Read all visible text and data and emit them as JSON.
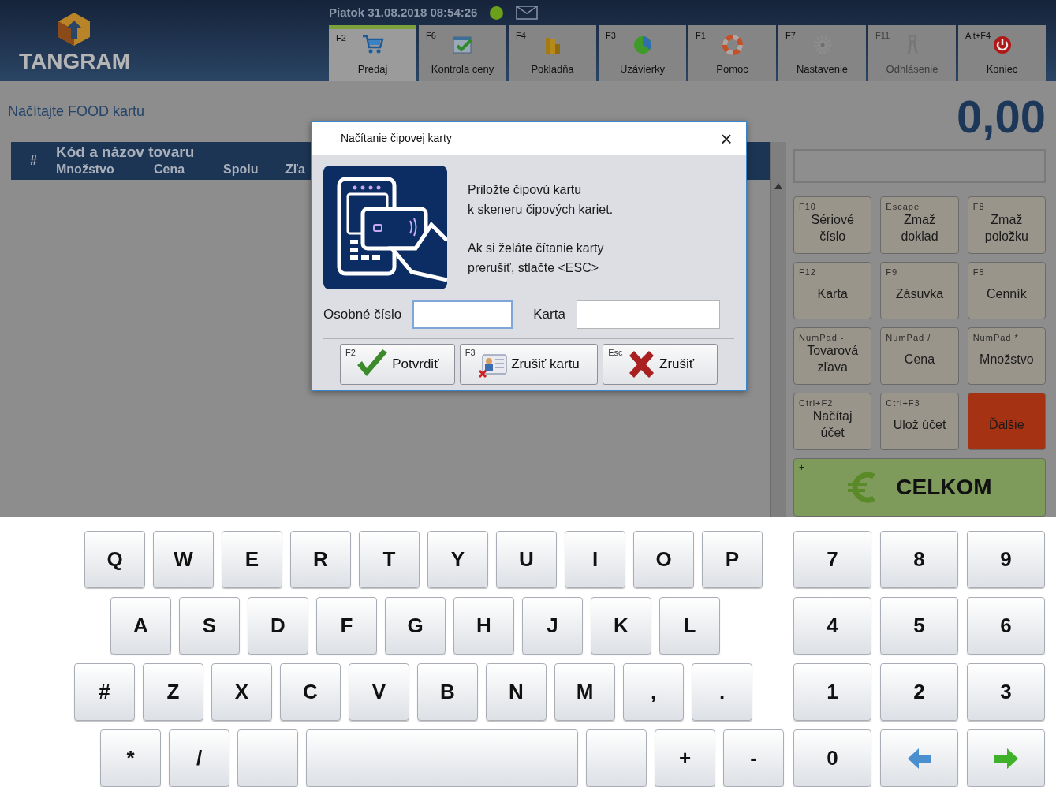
{
  "header": {
    "logo_text": "TANGRAM",
    "datetime": "Piatok 31.08.2018 08:54:26",
    "online": true
  },
  "tabs": [
    {
      "hotkey": "F2",
      "label": "Predaj",
      "selected": true,
      "disabled": false
    },
    {
      "hotkey": "F6",
      "label": "Kontrola ceny",
      "selected": false,
      "disabled": false
    },
    {
      "hotkey": "F4",
      "label": "Pokladňa",
      "selected": false,
      "disabled": false
    },
    {
      "hotkey": "F3",
      "label": "Uzávierky",
      "selected": false,
      "disabled": false
    },
    {
      "hotkey": "F1",
      "label": "Pomoc",
      "selected": false,
      "disabled": false
    },
    {
      "hotkey": "F7",
      "label": "Nastavenie",
      "selected": false,
      "disabled": false
    },
    {
      "hotkey": "F11",
      "label": "Odhlásenie",
      "selected": false,
      "disabled": true
    },
    {
      "hotkey": "Alt+F4",
      "label": "Koniec",
      "selected": false,
      "disabled": false
    }
  ],
  "status_message": "Načítajte FOOD kartu",
  "table": {
    "columns": [
      {
        "label": "#"
      },
      {
        "label": "Kód a názov tovaru"
      },
      {
        "label": "Množstvo"
      },
      {
        "label": "Cena"
      },
      {
        "label": "Spolu"
      },
      {
        "label": "Zľa"
      }
    ]
  },
  "total": "0,00",
  "function_buttons": [
    {
      "hotkey": "F10",
      "label": "Sériové číslo",
      "kind": "normal"
    },
    {
      "hotkey": "Escape",
      "label": "Zmaž doklad",
      "kind": "normal"
    },
    {
      "hotkey": "F8",
      "label": "Zmaž položku",
      "kind": "normal"
    },
    {
      "hotkey": "F12",
      "label": "Karta",
      "kind": "normal"
    },
    {
      "hotkey": "F9",
      "label": "Zásuvka",
      "kind": "normal"
    },
    {
      "hotkey": "F5",
      "label": "Cenník",
      "kind": "normal"
    },
    {
      "hotkey": "NumPad -",
      "label": "Tovarová zľava",
      "kind": "normal"
    },
    {
      "hotkey": "NumPad /",
      "label": "Cena",
      "kind": "normal"
    },
    {
      "hotkey": "NumPad *",
      "label": "Množstvo",
      "kind": "normal"
    },
    {
      "hotkey": "Ctrl+F2",
      "label": "Načítaj účet",
      "kind": "normal"
    },
    {
      "hotkey": "Ctrl+F3",
      "label": "Ulož účet",
      "kind": "normal"
    },
    {
      "label": "Ďalšie",
      "kind": "accent"
    }
  ],
  "total_button": {
    "hotkey": "+",
    "label": "CELKOM"
  },
  "dialog": {
    "title": "Načítanie čipovej karty",
    "close": "×",
    "paragraphs": [
      "Priložte čipovú kartu\nk skeneru čipových kariet.",
      "Ak si želáte čítanie karty\nprerušiť, stlačte <ESC>"
    ],
    "fields": [
      {
        "label": "Osobné číslo",
        "focused": true
      },
      {
        "label": "Karta",
        "focused": false
      }
    ],
    "buttons": [
      {
        "hotkey": "F2",
        "label": "Potvrdiť"
      },
      {
        "hotkey": "F3",
        "label": "Zrušiť kartu"
      },
      {
        "hotkey": "Esc",
        "label": "Zrušiť"
      }
    ]
  },
  "keyboard": {
    "rows": [
      [
        {
          "kind": "char",
          "label": "Q"
        },
        {
          "kind": "char",
          "label": "W"
        },
        {
          "kind": "char",
          "label": "E"
        },
        {
          "kind": "char",
          "label": "R"
        },
        {
          "kind": "char",
          "label": "T"
        },
        {
          "kind": "char",
          "label": "Y"
        },
        {
          "kind": "char",
          "label": "U"
        },
        {
          "kind": "char",
          "label": "I"
        },
        {
          "kind": "char",
          "label": "O"
        },
        {
          "kind": "char",
          "label": "P"
        }
      ],
      [
        {
          "kind": "char",
          "label": "A"
        },
        {
          "kind": "char",
          "label": "S"
        },
        {
          "kind": "char",
          "label": "D"
        },
        {
          "kind": "char",
          "label": "F"
        },
        {
          "kind": "char",
          "label": "G"
        },
        {
          "kind": "char",
          "label": "H"
        },
        {
          "kind": "char",
          "label": "J"
        },
        {
          "kind": "char",
          "label": "K"
        },
        {
          "kind": "char",
          "label": "L"
        }
      ],
      [
        {
          "kind": "char",
          "label": "#"
        },
        {
          "kind": "char",
          "label": "Z"
        },
        {
          "kind": "char",
          "label": "X"
        },
        {
          "kind": "char",
          "label": "C"
        },
        {
          "kind": "char",
          "label": "V"
        },
        {
          "kind": "char",
          "label": "B"
        },
        {
          "kind": "char",
          "label": "N"
        },
        {
          "kind": "char",
          "label": "M"
        },
        {
          "kind": "char",
          "label": ","
        },
        {
          "kind": "char",
          "label": "."
        }
      ],
      [
        {
          "kind": "char",
          "label": "*"
        },
        {
          "kind": "char",
          "label": "/"
        },
        {
          "kind": "blank"
        },
        {
          "kind": "space"
        },
        {
          "kind": "blank"
        },
        {
          "kind": "char",
          "label": "+"
        },
        {
          "kind": "char",
          "label": "-"
        }
      ]
    ],
    "numpad": [
      [
        {
          "kind": "char",
          "label": "7"
        },
        {
          "kind": "char",
          "label": "8"
        },
        {
          "kind": "char",
          "label": "9"
        }
      ],
      [
        {
          "kind": "char",
          "label": "4"
        },
        {
          "kind": "char",
          "label": "5"
        },
        {
          "kind": "char",
          "label": "6"
        }
      ],
      [
        {
          "kind": "char",
          "label": "1"
        },
        {
          "kind": "char",
          "label": "2"
        },
        {
          "kind": "char",
          "label": "3"
        }
      ],
      [
        {
          "kind": "char",
          "label": "0"
        },
        {
          "kind": "arrow-left"
        },
        {
          "kind": "arrow-right"
        }
      ]
    ]
  }
}
